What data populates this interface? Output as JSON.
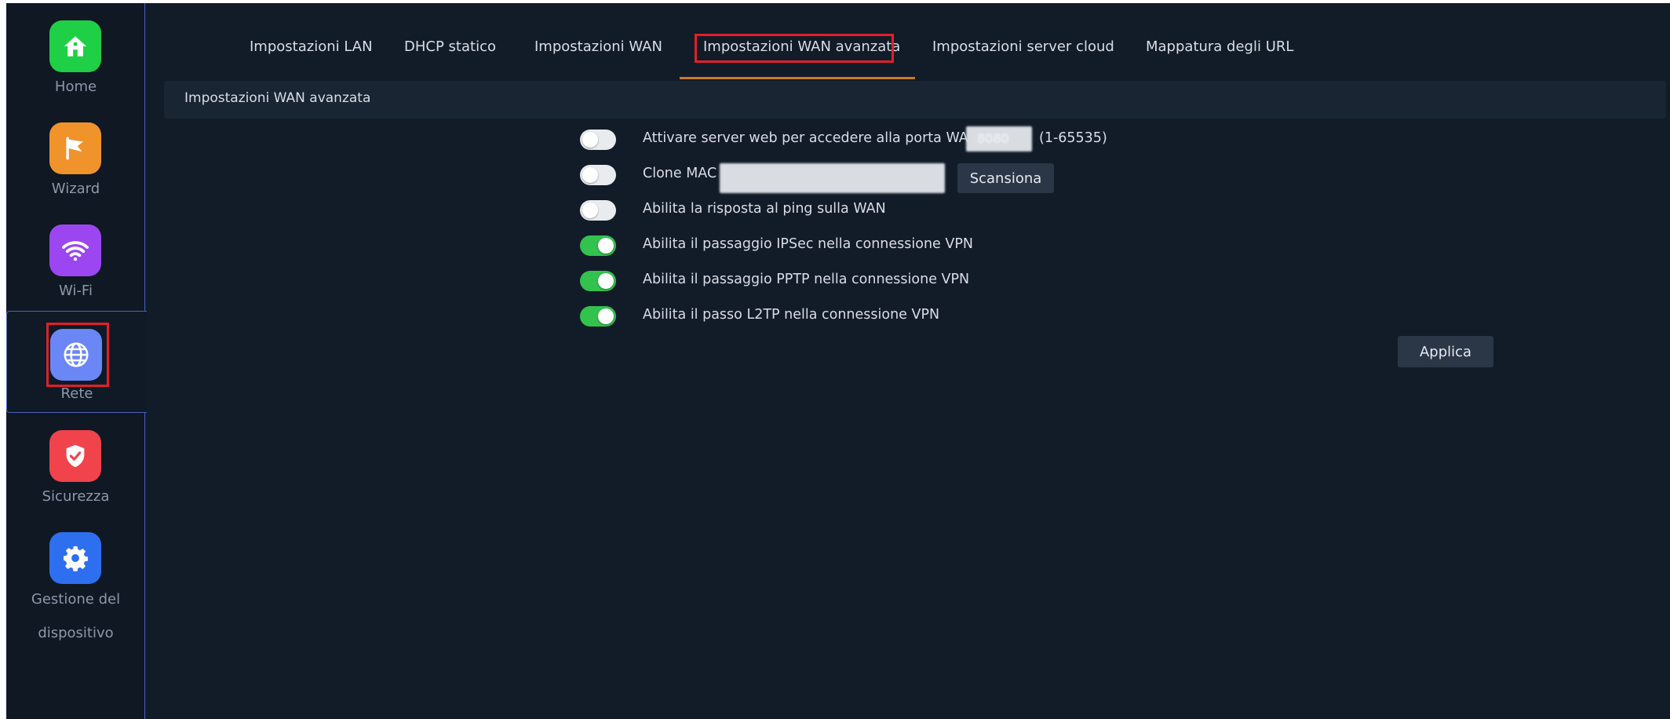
{
  "sidebar": {
    "items": [
      {
        "label": "Home",
        "icon": "home-icon",
        "color": "#1fcf45"
      },
      {
        "label": "Wizard",
        "icon": "flag-icon",
        "color": "#f0932b"
      },
      {
        "label": "Wi-Fi",
        "icon": "wifi-icon",
        "color": "#9b46f0"
      },
      {
        "label": "Rete",
        "icon": "globe-icon",
        "color": "#6b86f5"
      },
      {
        "label": "Sicurezza",
        "icon": "shield-check-icon",
        "color": "#f0434b"
      },
      {
        "label_line1": "Gestione del",
        "label_line2": "dispositivo",
        "icon": "gear-icon",
        "color": "#2e6ff0"
      }
    ],
    "active": "Rete"
  },
  "tabs": [
    {
      "label": "Impostazioni LAN"
    },
    {
      "label": "DHCP statico"
    },
    {
      "label": "Impostazioni WAN"
    },
    {
      "label": "Impostazioni WAN avanzata",
      "active": true
    },
    {
      "label": "Impostazioni server cloud"
    },
    {
      "label": "Mappatura degli URL"
    }
  ],
  "section": {
    "title": "Impostazioni WAN avanzata"
  },
  "form": {
    "web_server": {
      "label": "Attivare server web per accedere alla porta WAN",
      "port": "8080",
      "range": "(1-65535)",
      "enabled": false
    },
    "clone_mac": {
      "label": "Clone MAC",
      "value": "",
      "button": "Scansiona",
      "enabled": false
    },
    "ping": {
      "label": "Abilita la risposta al ping sulla WAN",
      "enabled": false
    },
    "ipsec": {
      "label": "Abilita il passaggio IPSec nella connessione VPN",
      "enabled": true
    },
    "pptp": {
      "label": "Abilita il passaggio PPTP nella connessione VPN",
      "enabled": true
    },
    "l2tp": {
      "label": "Abilita il passo L2TP nella connessione VPN",
      "enabled": true
    }
  },
  "actions": {
    "apply": "Applica"
  },
  "colors": {
    "accent": "#c97a2a",
    "toggle_on": "#32c24d",
    "highlight": "#e0202a",
    "background": "#121c28"
  }
}
